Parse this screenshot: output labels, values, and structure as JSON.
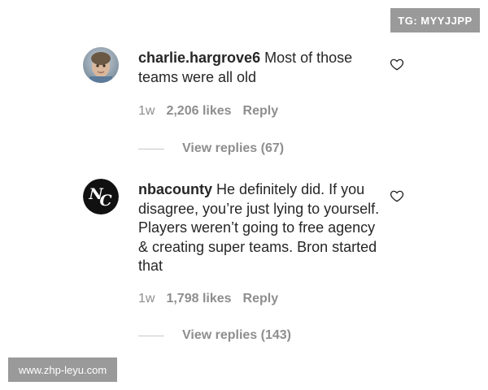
{
  "watermarks": {
    "top": "TG: MYYJJPP",
    "bottom": "www.zhp-leyu.com"
  },
  "comments": [
    {
      "username": "charlie.hargrove6",
      "text": "Most of those teams were all old",
      "time": "1w",
      "likes": "2,206 likes",
      "reply_label": "Reply",
      "view_replies": "View replies (67)",
      "avatar": "child-photo"
    },
    {
      "username": "nbacounty",
      "text": "He definitely did. If you disagree, you’re just lying to yourself. Players weren’t going to free agency & creating super teams. Bron started that",
      "time": "1w",
      "likes": "1,798 likes",
      "reply_label": "Reply",
      "view_replies": "View replies (143)",
      "avatar": "nc-logo"
    }
  ],
  "colors": {
    "text": "#262626",
    "meta": "#8e8e8e",
    "watermark_bg": "#9a9a9a"
  }
}
